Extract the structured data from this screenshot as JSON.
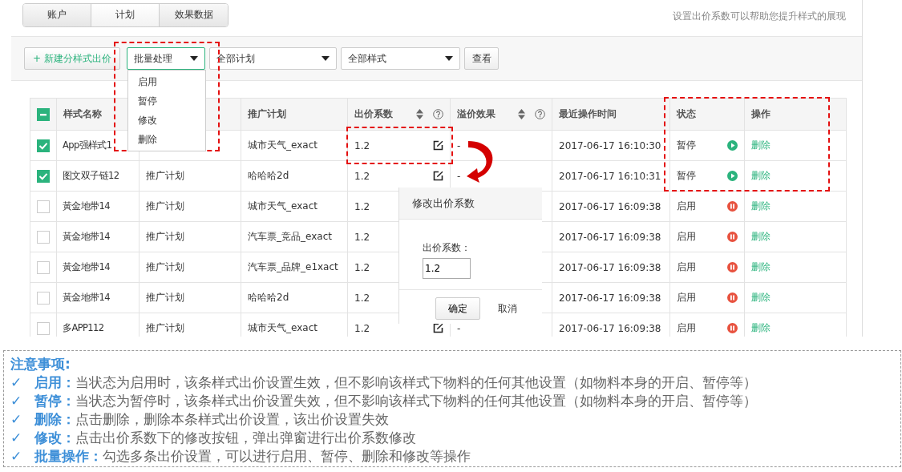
{
  "tabs": [
    {
      "label": "账户",
      "selected": false
    },
    {
      "label": "计划",
      "selected": true
    },
    {
      "label": "效果数据",
      "selected": false
    }
  ],
  "hint": "设置出价系数可以帮助您提升样式的展现",
  "toolbar": {
    "new_button": "+ 新建分样式出价",
    "batch_select": {
      "value": "批量处理",
      "expanded": true,
      "options": [
        "启用",
        "暂停",
        "修改",
        "删除"
      ]
    },
    "plan_select": {
      "value": "全部计划"
    },
    "style_select": {
      "value": "全部样式"
    },
    "view_button": "查看"
  },
  "table": {
    "select_all_partial": true,
    "columns": [
      {
        "label": "样式名称"
      },
      {},
      {
        "label": "推广计划"
      },
      {
        "label": "出价系数",
        "sortable": true,
        "help": true
      },
      {
        "label": "溢价效果",
        "sortable": true,
        "help": true
      },
      {
        "label": "最近操作时间"
      },
      {
        "label": "状态"
      },
      {
        "label": "操作"
      }
    ],
    "rows": [
      {
        "checked": true,
        "name": "App强样式1",
        "plan": "城市天气_exact",
        "bid": "1.2",
        "premium": "-",
        "time": "2017-06-17 16:10:30",
        "status": "暂停",
        "paused": true,
        "action": "删除"
      },
      {
        "checked": true,
        "name": "图文双子链12",
        "plan_type": "推广计划",
        "plan": "哈哈哈2d",
        "bid": "1.2",
        "premium": "-",
        "time": "2017-06-17 16:10:31",
        "status": "暂停",
        "paused": true,
        "action": "删除"
      },
      {
        "checked": false,
        "name": "黃金地带14",
        "plan_type": "推广计划",
        "plan": "城市天气_exact",
        "bid": "1.2",
        "time": "2017-06-17 16:09:38",
        "status": "启用",
        "paused": false,
        "action": "删除"
      },
      {
        "checked": false,
        "name": "黃金地带14",
        "plan_type": "推广计划",
        "plan": "汽车票_竞品_exact",
        "bid": "1.2",
        "time": "2017-06-17 16:09:38",
        "status": "启用",
        "paused": false,
        "action": "删除"
      },
      {
        "checked": false,
        "name": "黃金地带14",
        "plan_type": "推广计划",
        "plan": "汽车票_品牌_e1xact",
        "bid": "1.2",
        "time": "2017-06-17 16:09:38",
        "status": "启用",
        "paused": false,
        "action": "删除"
      },
      {
        "checked": false,
        "name": "黃金地带14",
        "plan_type": "推广计划",
        "plan": "哈哈哈2d",
        "bid": "1.2",
        "time": "2017-06-17 16:09:38",
        "status": "启用",
        "paused": false,
        "action": "删除"
      },
      {
        "checked": false,
        "name": "多APP112",
        "plan_type": "推广计划",
        "plan": "城市天气_exact",
        "bid": "1.2",
        "premium": "-",
        "time": "2017-06-17 16:09:38",
        "status": "启用",
        "paused": false,
        "action": "删除"
      }
    ]
  },
  "popup": {
    "title": "修改出价系数",
    "field_label": "出价系数：",
    "value": "1.2",
    "buttons": [
      {
        "label": "确定",
        "kind": "primary"
      },
      {
        "label": "取消",
        "kind": "link"
      }
    ]
  },
  "notes": {
    "title": "注意事项:",
    "items": [
      {
        "mark": "✓",
        "label": "启用：",
        "text": "当状态为启用时，该条样式出价设置生效，但不影响该样式下物料的任何其他设置（如物料本身的开启、暂停等）"
      },
      {
        "mark": "✓",
        "label": "暂停：",
        "text": "当状态为暂停时，该条样式出价设置失效，但不影响该样式下物料的任何其他设置（如物料本身的开启、暂停等）"
      },
      {
        "mark": "✓",
        "label": "删除：",
        "text": "点击删除，删除本条样式出价设置，该出价设置失效"
      },
      {
        "mark": "✓",
        "label": "修改：",
        "text": "点击出价系数下的修改按钮，弹出弹窗进行出价系数修改"
      },
      {
        "mark": "✓",
        "label": "批量操作：",
        "text": "勾选多条出价设置，可以进行启用、暂停、删除和修改等操作"
      }
    ]
  }
}
